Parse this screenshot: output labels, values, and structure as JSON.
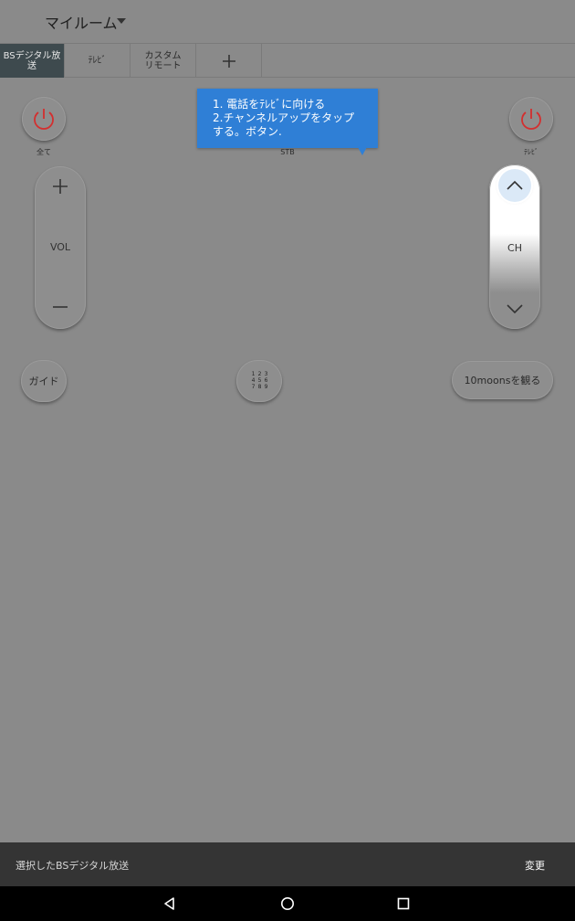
{
  "header": {
    "room_title": "マイルーム"
  },
  "tabs": [
    {
      "label_line1": "BSデジタル放",
      "label_line2": "送",
      "active": true
    },
    {
      "label_line1": "ﾃﾚﾋﾞ",
      "label_line2": ""
    },
    {
      "label_line1": "カスタム",
      "label_line2": "リモート"
    }
  ],
  "tooltip": {
    "line1": "1. 電話をﾃﾚﾋﾞに向ける",
    "line2": "2.チャンネルアップをタップ",
    "line3": "する。ボタン."
  },
  "power_buttons": {
    "all_label": "全て",
    "stb_label": "STB",
    "tv_label": "ﾃﾚﾋﾞ",
    "color": "#d32f2f"
  },
  "volume": {
    "label": "VOL"
  },
  "channel": {
    "label": "CH"
  },
  "buttons": {
    "guide": "ガイド",
    "numpad_digits": [
      "1",
      "2",
      "3",
      "4",
      "5",
      "6",
      "7",
      "8",
      "9"
    ],
    "watch": "10moonsを観る"
  },
  "snackbar": {
    "message": "選択したBSデジタル放送",
    "action": "変更"
  },
  "colors": {
    "tooltip_bg": "#2f7fd6",
    "active_tab_bg": "#3e4a4e",
    "snackbar_bg": "#343434"
  }
}
